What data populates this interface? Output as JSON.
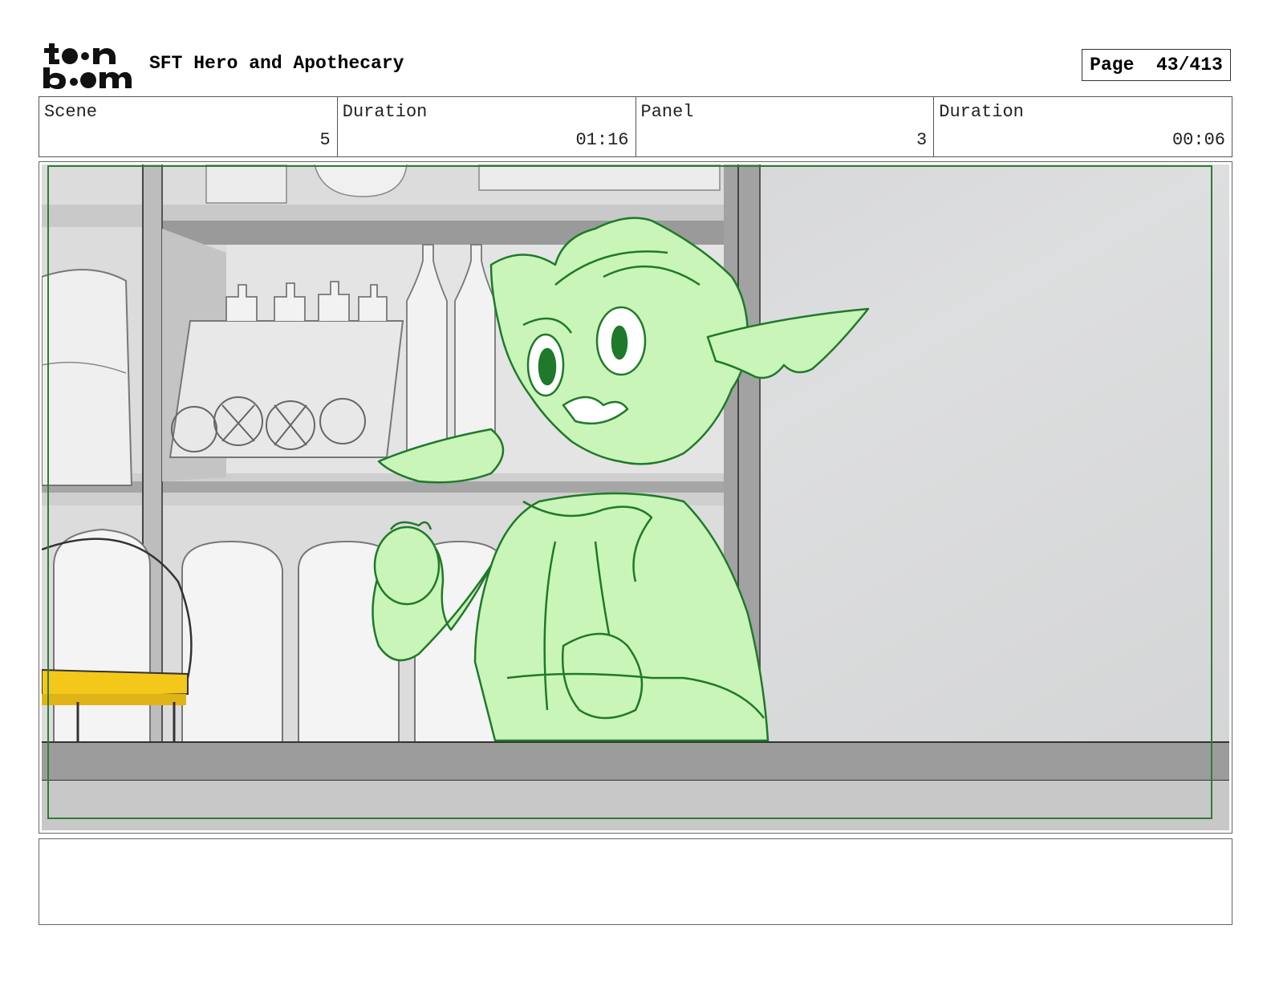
{
  "header": {
    "logo_text": "toon boom",
    "project_title": "SFT Hero and Apothecary",
    "page_label": "Page",
    "page_number": "43/413"
  },
  "info": {
    "scene_label": "Scene",
    "scene_value": "5",
    "scene_duration_label": "Duration",
    "scene_duration_value": "01:16",
    "panel_label": "Panel",
    "panel_value": "3",
    "panel_duration_label": "Duration",
    "panel_duration_value": "00:06"
  },
  "panel": {
    "character_fill": "#c9f5b8",
    "character_line": "#1e7a2a",
    "safe_frame_color": "#2e7d32",
    "background_gray": "#d8d9da",
    "accent_yellow": "#f4c81a"
  },
  "notes": {
    "text": ""
  }
}
